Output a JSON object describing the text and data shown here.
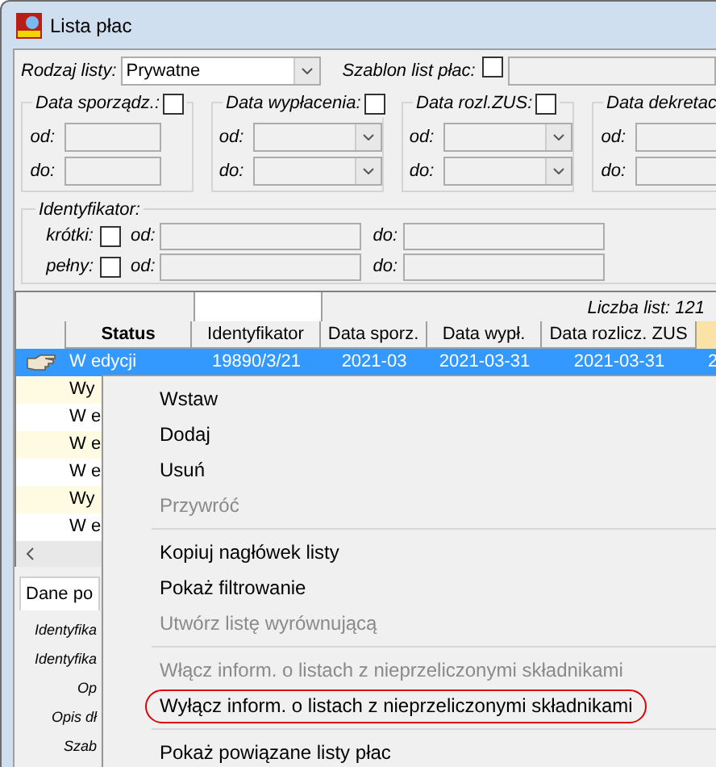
{
  "window": {
    "title": "Lista płac"
  },
  "list_type": {
    "label": "Rodzaj listy:",
    "value": "Prywatne"
  },
  "template": {
    "label": "Szablon list płac:",
    "checked": false
  },
  "date_groups": [
    {
      "label": "Data sporządz.:",
      "checked": false,
      "kind": "text",
      "from_label": "od:",
      "to_label": "do:"
    },
    {
      "label": "Data wypłacenia:",
      "checked": false,
      "kind": "combo",
      "from_label": "od:",
      "to_label": "do:"
    },
    {
      "label": "Data rozl.ZUS:",
      "checked": false,
      "kind": "combo",
      "from_label": "od:",
      "to_label": "do:"
    },
    {
      "label": "Data dekretac",
      "kind": "text",
      "from_label": "od:",
      "to_label": "do:"
    }
  ],
  "identifier": {
    "title": "Identyfikator:",
    "rows": [
      {
        "label": "krótki:",
        "checked": false,
        "from_label": "od:",
        "to_label": "do:"
      },
      {
        "label": "pełny:",
        "checked": false,
        "from_label": "od:",
        "to_label": "do:"
      }
    ]
  },
  "table": {
    "count": "Liczba list: 121",
    "columns": [
      "Status",
      "Identyfikator",
      "Data sporz.",
      "Data wypł.",
      "Data rozlicz. ZUS"
    ],
    "rows": [
      {
        "selected": true,
        "cells": [
          "W edycji",
          "19890/3/21",
          "2021-03",
          "2021-03-31",
          "2021-03-31",
          "2"
        ]
      },
      {
        "selected": false,
        "cells": [
          "Wy"
        ]
      },
      {
        "selected": false,
        "cells": [
          "W e"
        ]
      },
      {
        "selected": false,
        "cells": [
          "W e"
        ]
      },
      {
        "selected": false,
        "cells": [
          "W e"
        ]
      },
      {
        "selected": false,
        "cells": [
          "Wy"
        ]
      },
      {
        "selected": false,
        "cells": [
          "W e"
        ]
      }
    ]
  },
  "details": {
    "tabs": [
      {
        "label": "Dane po",
        "selected": true
      }
    ],
    "labels": [
      "Identyfika",
      "Identyfika",
      "Op",
      "Opis dł",
      "Szab"
    ]
  },
  "context_menu": [
    {
      "kind": "item",
      "label": "Wstaw",
      "disabled": false,
      "highlighted": false
    },
    {
      "kind": "item",
      "label": "Dodaj",
      "disabled": false,
      "highlighted": false
    },
    {
      "kind": "item",
      "label": "Usuń",
      "disabled": false,
      "highlighted": false
    },
    {
      "kind": "item",
      "label": "Przywróć",
      "disabled": true,
      "highlighted": false
    },
    {
      "kind": "separator"
    },
    {
      "kind": "item",
      "label": "Kopiuj nagłówek listy",
      "disabled": false,
      "highlighted": false
    },
    {
      "kind": "item",
      "label": "Pokaż filtrowanie",
      "disabled": false,
      "highlighted": false
    },
    {
      "kind": "item",
      "label": "Utwórz listę wyrównującą",
      "disabled": true,
      "highlighted": false
    },
    {
      "kind": "separator"
    },
    {
      "kind": "item",
      "label": "Włącz inform. o listach z nieprzeliczonymi składnikami",
      "disabled": true,
      "highlighted": false
    },
    {
      "kind": "item",
      "label": "Wyłącz inform. o listach z nieprzeliczonymi składnikami",
      "disabled": false,
      "highlighted": true
    },
    {
      "kind": "separator"
    },
    {
      "kind": "item",
      "label": "Pokaż powiązane listy płac",
      "disabled": false,
      "highlighted": false
    }
  ]
}
